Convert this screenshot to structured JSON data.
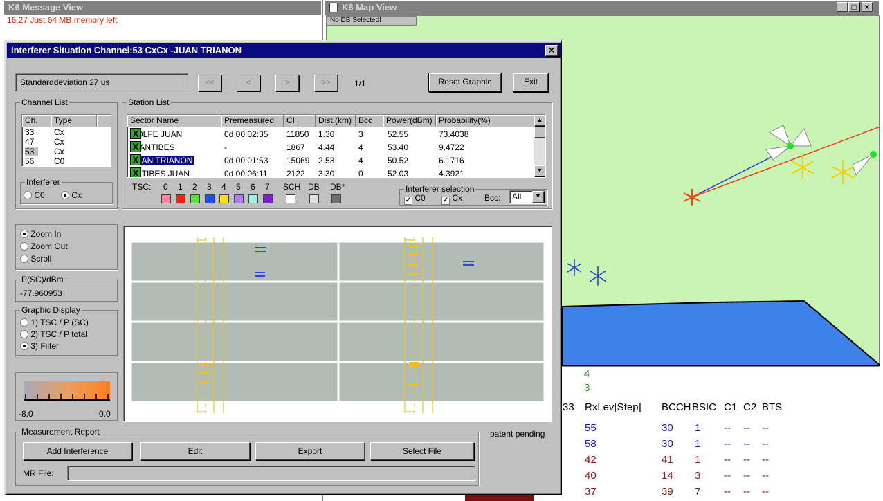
{
  "message_view": {
    "title": "K6 Message View",
    "log_line": "16:27 Just 64 MB memory left"
  },
  "map_view": {
    "title": "K6 Map View",
    "db_status": "No DB Selected!",
    "btn_min": "_",
    "btn_max": "□",
    "btn_close": "×",
    "rxlev_partial": [
      "4",
      "3"
    ],
    "table_headers": [
      "33",
      "RxLev[Step]",
      "BCCH",
      "BSIC",
      "C1",
      "C2",
      "BTS"
    ],
    "table_rows": [
      {
        "rxlev": "55",
        "bcch": "30",
        "bsic": "1",
        "c1": "--",
        "c2": "--",
        "bts": "--",
        "color": "#1a1ab0"
      },
      {
        "rxlev": "58",
        "bcch": "30",
        "bsic": "1",
        "c1": "--",
        "c2": "--",
        "bts": "--",
        "color": "#1a1ab0"
      },
      {
        "rxlev": "42",
        "bcch": "41",
        "bsic": "1",
        "c1": "--",
        "c2": "--",
        "bts": "--",
        "color": "#8a1a1a"
      },
      {
        "rxlev": "40",
        "bcch": "14",
        "bsic": "3",
        "c1": "--",
        "c2": "--",
        "bts": "--",
        "color": "#8a1a1a"
      },
      {
        "rxlev": "37",
        "bcch": "39",
        "bsic": "7",
        "c1": "--",
        "c2": "--",
        "bts": "--",
        "color": "#8a1a1a"
      }
    ]
  },
  "dialog": {
    "title": "Interferer Situation Channel:53 CxCx -JUAN TRIANON",
    "close": "×",
    "std_dev": "Standarddeviation 27 us",
    "nav": {
      "first": "<<",
      "prev": "<",
      "next": ">",
      "last": ">>",
      "page": "1/1"
    },
    "reset_btn": "Reset Graphic",
    "exit_btn": "Exit",
    "channel_list": {
      "label": "Channel List",
      "headers": [
        "Ch.",
        "Type"
      ],
      "rows": [
        [
          "33",
          "Cx"
        ],
        [
          "47",
          "Cx"
        ],
        [
          "53",
          "Cx"
        ],
        [
          "56",
          "C0"
        ]
      ]
    },
    "interferer": {
      "label": "Interferer",
      "c0": "C0",
      "cx": "Cx"
    },
    "station_list": {
      "label": "Station List",
      "headers": [
        "Sector Name",
        "Premeasured",
        "CI",
        "Dist.(km)",
        "Bcc",
        "Power(dBm)",
        "Probability(%)"
      ],
      "rows": [
        [
          "GOLFE JUAN",
          "0d 00:02:35",
          "11850",
          "1.30",
          "3",
          "52.55",
          "73.4038"
        ],
        [
          "ZI ANTIBES",
          "-",
          "1867",
          "4.44",
          "4",
          "53.40",
          "9.4722"
        ],
        [
          "JUAN TRIANON",
          "0d 00:01:53",
          "15069",
          "2.53",
          "4",
          "50.52",
          "6.1716"
        ],
        [
          "ANTIBES JUAN",
          "0d 00:06:11",
          "2122",
          "3.30",
          "0",
          "52.03",
          "4.3921"
        ]
      ]
    },
    "tsc": {
      "label": "TSC:",
      "items": [
        {
          "n": "0",
          "color": "#ff80a0"
        },
        {
          "n": "1",
          "color": "#ff2010"
        },
        {
          "n": "2",
          "color": "#60e040"
        },
        {
          "n": "3",
          "color": "#1a50ff"
        },
        {
          "n": "4",
          "color": "#ffe000"
        },
        {
          "n": "5",
          "color": "#b080ff"
        },
        {
          "n": "6",
          "color": "#a0f0e0"
        },
        {
          "n": "7",
          "color": "#8020d0"
        }
      ],
      "sch": "SCH",
      "db": "DB",
      "dbx": "DB*",
      "sch_color": "#ffffff",
      "db_color": "#e0e0e0",
      "dbx_color": "#707070"
    },
    "interferer_selection": {
      "label": "Interferer selection",
      "c0": "C0",
      "cx": "Cx",
      "bcc_label": "Bcc:",
      "bcc_value": "All"
    },
    "zoom": {
      "in": "Zoom In",
      "out": "Zoom Out",
      "scroll": "Scroll"
    },
    "psc": {
      "label": "P(SC)/dBm",
      "value": "-77.960953"
    },
    "graphic_display": {
      "label": "Graphic Display",
      "opt1": "1) TSC / P (SC)",
      "opt2": "2) TSC / P total",
      "opt3": "3) Filter"
    },
    "scale": {
      "min": "-8.0",
      "max": "0.0"
    },
    "measurement_report": {
      "label": "Measurement Report",
      "add": "Add Interference",
      "edit": "Edit",
      "export": "Export",
      "select_file": "Select File",
      "mr_file_label": "MR File:"
    },
    "patent": "patent pending"
  }
}
